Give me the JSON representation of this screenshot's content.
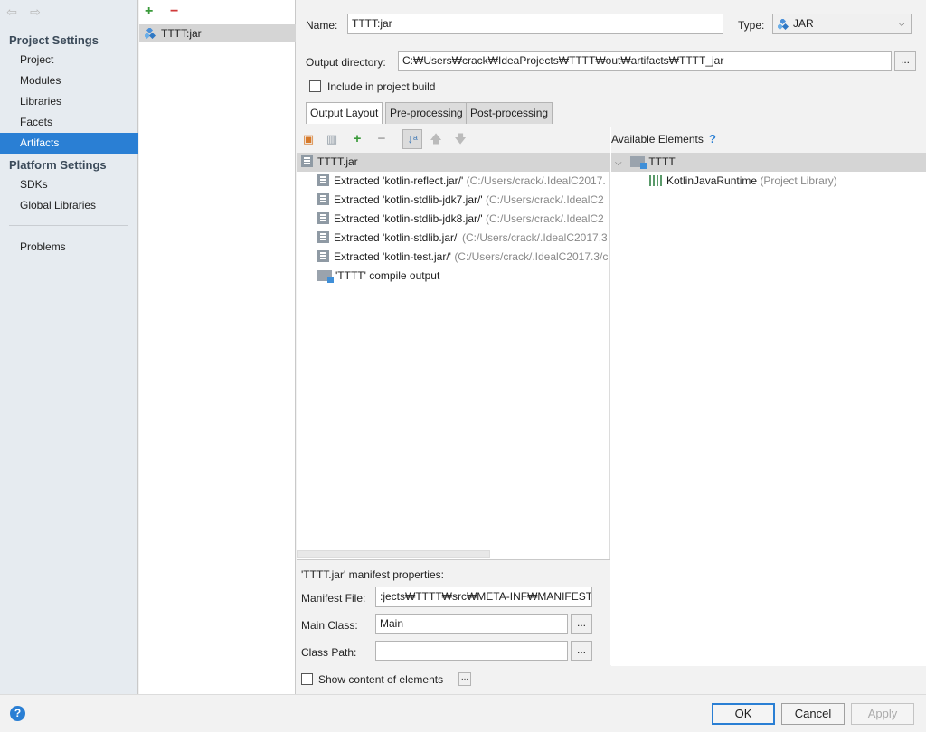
{
  "nav": {
    "section_project": "Project Settings",
    "project_items": [
      "Project",
      "Modules",
      "Libraries",
      "Facets",
      "Artifacts"
    ],
    "section_platform": "Platform Settings",
    "platform_items": [
      "SDKs",
      "Global Libraries"
    ],
    "problems": "Problems"
  },
  "artifacts": {
    "add": "+",
    "remove": "−",
    "item": "TTTT:jar"
  },
  "form": {
    "name_label": "Name:",
    "name_value": "TTTT:jar",
    "type_label": "Type:",
    "type_value": "JAR",
    "output_label": "Output directory:",
    "output_value": "C:₩Users₩crack₩IdeaProjects₩TTTT₩out₩artifacts₩TTTT_jar",
    "include_label": "Include in project build",
    "browse": "..."
  },
  "tabs": [
    "Output Layout",
    "Pre-processing",
    "Post-processing"
  ],
  "layout": {
    "root": "TTTT.jar",
    "items": [
      {
        "name": "Extracted 'kotlin-reflect.jar/'",
        "path": "(C:/Users/crack/.IdealC2017."
      },
      {
        "name": "Extracted 'kotlin-stdlib-jdk7.jar/'",
        "path": "(C:/Users/crack/.IdealC2"
      },
      {
        "name": "Extracted 'kotlin-stdlib-jdk8.jar/'",
        "path": "(C:/Users/crack/.IdealC2"
      },
      {
        "name": "Extracted 'kotlin-stdlib.jar/'",
        "path": "(C:/Users/crack/.IdealC2017.3"
      },
      {
        "name": "Extracted 'kotlin-test.jar/'",
        "path": "(C:/Users/crack/.IdealC2017.3/c"
      }
    ],
    "compile_output": "'TTTT' compile output"
  },
  "available": {
    "title": "Available Elements",
    "help": "?",
    "module": "TTTT",
    "lib_name": "KotlinJavaRuntime",
    "lib_type": "(Project Library)"
  },
  "manifest": {
    "title": "'TTTT.jar' manifest properties:",
    "file_label": "Manifest File:",
    "file_value": ":jects₩TTTT₩src₩META-INF₩MANIFEST.MF",
    "main_label": "Main Class:",
    "main_value": "Main",
    "cp_label": "Class Path:",
    "cp_value": "",
    "show_content": "Show content of elements"
  },
  "buttons": {
    "ok": "OK",
    "cancel": "Cancel",
    "apply": "Apply",
    "help": "?"
  },
  "colors": {
    "accent": "#2a7fd4",
    "add": "#3a9a3a",
    "remove": "#d03a3a"
  }
}
